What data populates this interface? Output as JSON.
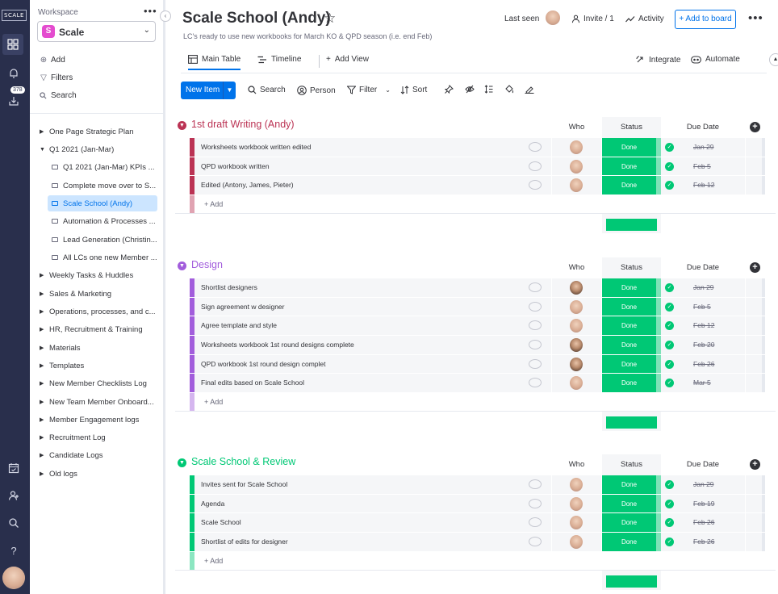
{
  "rail": {
    "logo": "SCALE",
    "badge": "378",
    "icons": [
      "workspaces-icon",
      "notifications-icon",
      "inbox-icon",
      "my-work-icon",
      "invite-members-icon",
      "search-icon",
      "help-icon"
    ]
  },
  "sidebar": {
    "workspace_label": "Workspace",
    "workspace_letter": "S",
    "workspace_name": "Scale",
    "actions": {
      "add": "Add",
      "filters": "Filters",
      "search": "Search"
    },
    "tree": [
      {
        "label": "One Page Strategic Plan",
        "type": "folder",
        "expanded": false
      },
      {
        "label": "Q1 2021 (Jan-Mar)",
        "type": "folder",
        "expanded": true
      },
      {
        "label": "Q1 2021 (Jan-Mar) KPIs ...",
        "type": "board"
      },
      {
        "label": "Complete move over to S...",
        "type": "board"
      },
      {
        "label": "Scale School (Andy)",
        "type": "board",
        "selected": true
      },
      {
        "label": "Automation & Processes ...",
        "type": "board"
      },
      {
        "label": "Lead Generation (Christin...",
        "type": "board"
      },
      {
        "label": "All LCs one new Member ...",
        "type": "board"
      },
      {
        "label": "Weekly Tasks & Huddles",
        "type": "folder"
      },
      {
        "label": "Sales & Marketing",
        "type": "folder"
      },
      {
        "label": "Operations, processes, and c...",
        "type": "folder"
      },
      {
        "label": "HR, Recruitment & Training",
        "type": "folder"
      },
      {
        "label": "Materials",
        "type": "folder"
      },
      {
        "label": "Templates",
        "type": "folder"
      },
      {
        "label": "New Member Checklists Log",
        "type": "folder"
      },
      {
        "label": "New Team Member Onboard...",
        "type": "folder"
      },
      {
        "label": "Member Engagement logs",
        "type": "folder"
      },
      {
        "label": "Recruitment Log",
        "type": "folder"
      },
      {
        "label": "Candidate Logs",
        "type": "folder"
      },
      {
        "label": "Old logs",
        "type": "folder"
      }
    ]
  },
  "header": {
    "title": "Scale School (Andy)",
    "subtitle": "LC's ready to use new workbooks for March KO & QPD season (i.e. end Feb)",
    "last_seen": "Last seen",
    "invite": "Invite / 1",
    "activity": "Activity",
    "add_to_board": "Add to board"
  },
  "tabs": {
    "main_table": "Main Table",
    "timeline": "Timeline",
    "add_view": "Add View",
    "integrate": "Integrate",
    "automate": "Automate"
  },
  "toolbar": {
    "new_item": "New Item",
    "search": "Search",
    "person": "Person",
    "filter": "Filter",
    "sort": "Sort"
  },
  "columns": {
    "who": "Who",
    "status": "Status",
    "due": "Due Date"
  },
  "add_label": "+ Add",
  "groups": [
    {
      "title": "1st draft Writing (Andy)",
      "color": "#bb3354",
      "items": [
        {
          "name": "Worksheets workbook written edited",
          "status": "Done",
          "due": "Jan 29",
          "person": "light"
        },
        {
          "name": "QPD workbook written",
          "status": "Done",
          "due": "Feb 5",
          "person": "light"
        },
        {
          "name": "Edited (Antony, James, Pieter)",
          "status": "Done",
          "due": "Feb 12",
          "person": "light"
        }
      ]
    },
    {
      "title": "Design",
      "color": "#a25ddc",
      "items": [
        {
          "name": "Shortlist designers",
          "status": "Done",
          "due": "Jan 29",
          "person": "dark"
        },
        {
          "name": "Sign agreement w designer",
          "status": "Done",
          "due": "Feb 5",
          "person": "light"
        },
        {
          "name": "Agree template and style",
          "status": "Done",
          "due": "Feb 12",
          "person": "light"
        },
        {
          "name": "Worksheets workbook 1st round designs complete",
          "status": "Done",
          "due": "Feb 20",
          "person": "dark"
        },
        {
          "name": "QPD workbook 1st round design complet",
          "status": "Done",
          "due": "Feb 26",
          "person": "dark"
        },
        {
          "name": "Final edits based on Scale School",
          "status": "Done",
          "due": "Mar 5",
          "person": "light"
        }
      ]
    },
    {
      "title": "Scale School & Review",
      "color": "#00c875",
      "items": [
        {
          "name": "Invites sent for Scale School",
          "status": "Done",
          "due": "Jan 29",
          "person": "light"
        },
        {
          "name": "Agenda",
          "status": "Done",
          "due": "Feb 19",
          "person": "light"
        },
        {
          "name": "Scale School",
          "status": "Done",
          "due": "Feb 26",
          "person": "light"
        },
        {
          "name": "Shortlist of edits for designer",
          "status": "Done",
          "due": "Feb 26",
          "person": "light"
        }
      ]
    }
  ],
  "colors": {
    "primary": "#0073ea",
    "done": "#00c875",
    "rail": "#292f4c"
  }
}
